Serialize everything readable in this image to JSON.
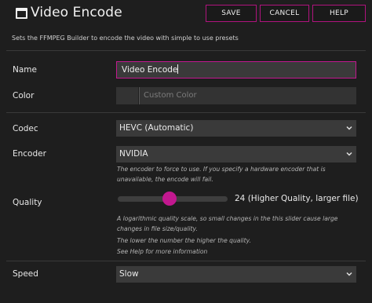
{
  "header": {
    "title": "Video Encode",
    "buttons": {
      "save": "SAVE",
      "cancel": "CANCEL",
      "help": "HELP"
    },
    "subtitle": "Sets the FFMPEG Builder to encode the video with simple to use presets"
  },
  "form": {
    "name": {
      "label": "Name",
      "value": "Video Encode"
    },
    "color": {
      "label": "Color",
      "placeholder": "Custom Color",
      "value": ""
    },
    "codec": {
      "label": "Codec",
      "selected": "HEVC (Automatic)"
    },
    "encoder": {
      "label": "Encoder",
      "selected": "NVIDIA",
      "help_lines": [
        "The encoder to force to use.  If you specify a hardware encoder that is",
        "unavailable, the encode will fail."
      ]
    },
    "quality": {
      "label": "Quality",
      "value": 24,
      "min": 0,
      "max": 51,
      "value_text": "24 (Higher Quality, larger file)",
      "help_lines": [
        "A logarithmic quality scale, so small changes in the this slider cause large",
        "changes in file size/quality.",
        "The lower the number the higher the quality.",
        "See Help for more information"
      ]
    },
    "speed": {
      "label": "Speed",
      "selected": "Slow"
    }
  },
  "colors": {
    "accent": "#c2188f",
    "background": "#1e1e1e",
    "field": "#3a3a3a"
  }
}
